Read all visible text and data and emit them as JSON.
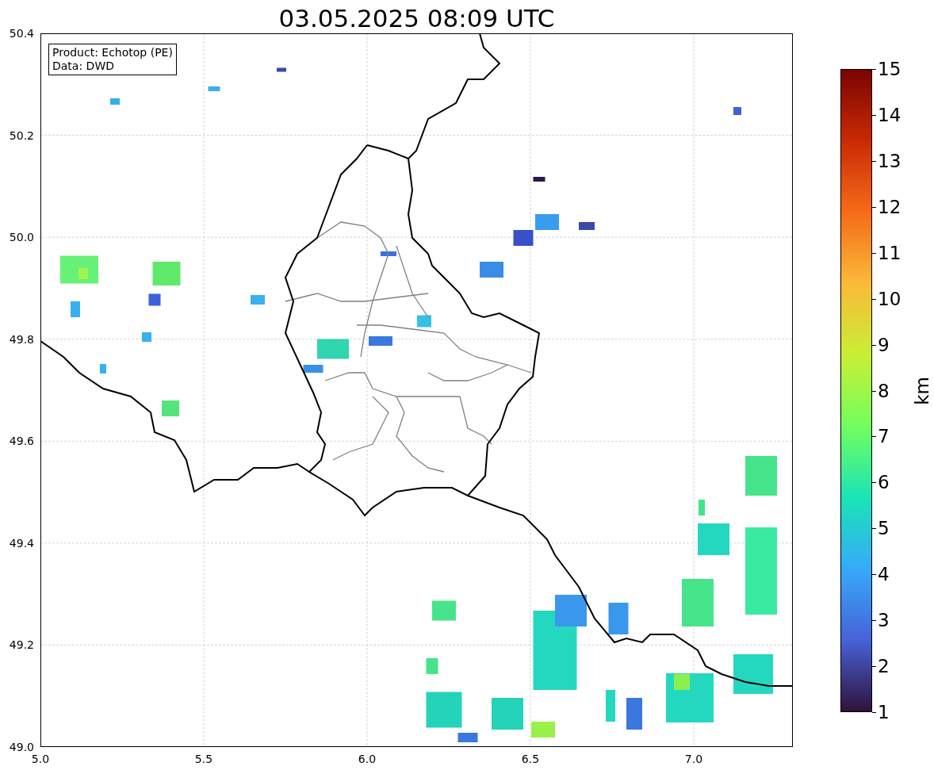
{
  "title": "03.05.2025 08:09 UTC",
  "info_box": {
    "lines": [
      "Product: Echotop (PE)",
      "Data: DWD"
    ]
  },
  "y_ticks": [
    "50.4",
    "50.2",
    "50.0",
    "49.8",
    "49.6",
    "49.4",
    "49.2",
    "49.0"
  ],
  "x_ticks": [
    "5.0",
    "5.5",
    "6.0",
    "6.5",
    "7.0"
  ],
  "colorbar": {
    "label": "km",
    "ticks": [
      "15",
      "14",
      "13",
      "12",
      "11",
      "10",
      "9",
      "8",
      "7",
      "6",
      "5",
      "4",
      "3",
      "2",
      "1"
    ]
  }
}
